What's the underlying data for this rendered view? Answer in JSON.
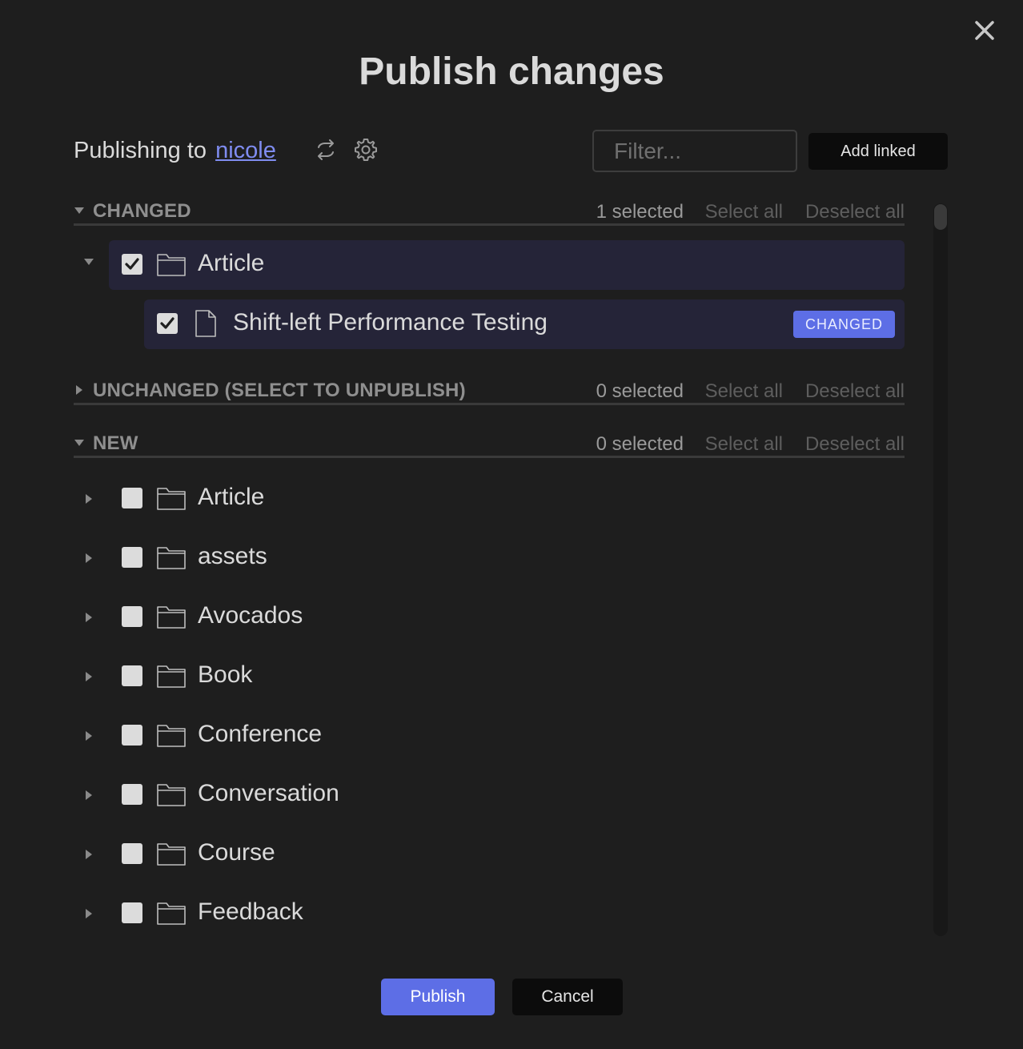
{
  "dialog": {
    "title": "Publish changes",
    "close_icon": "close-icon"
  },
  "publishing": {
    "prefix": "Publishing to",
    "target": "nicole",
    "swap_icon": "swap-arrows-icon",
    "settings_icon": "gear-icon"
  },
  "filter": {
    "placeholder": "Filter...",
    "value": ""
  },
  "add_linked_label": "Add linked",
  "sections": {
    "changed": {
      "title": "CHANGED",
      "expanded": true,
      "selected": "1 selected",
      "select_all": "Select all",
      "deselect_all": "Deselect all",
      "items": [
        {
          "label": "Article",
          "type": "folder",
          "checked": true,
          "expanded": true,
          "children": [
            {
              "label": "Shift-left Performance Testing",
              "type": "file",
              "checked": true,
              "badge": "CHANGED"
            }
          ]
        }
      ]
    },
    "unchanged": {
      "title": "UNCHANGED (SELECT TO UNPUBLISH)",
      "expanded": false,
      "selected": "0 selected",
      "select_all": "Select all",
      "deselect_all": "Deselect all"
    },
    "new": {
      "title": "NEW",
      "expanded": true,
      "selected": "0 selected",
      "select_all": "Select all",
      "deselect_all": "Deselect all",
      "items": [
        {
          "label": "Article",
          "type": "folder",
          "checked": false
        },
        {
          "label": "assets",
          "type": "folder",
          "checked": false
        },
        {
          "label": "Avocados",
          "type": "folder",
          "checked": false
        },
        {
          "label": "Book",
          "type": "folder",
          "checked": false
        },
        {
          "label": "Conference",
          "type": "folder",
          "checked": false
        },
        {
          "label": "Conversation",
          "type": "folder",
          "checked": false
        },
        {
          "label": "Course",
          "type": "folder",
          "checked": false
        },
        {
          "label": "Feedback",
          "type": "folder",
          "checked": false
        }
      ]
    }
  },
  "footer": {
    "publish_label": "Publish",
    "cancel_label": "Cancel"
  },
  "colors": {
    "accent": "#5d6ee6",
    "link": "#7f8cf0",
    "background": "#1e1e1e",
    "highlight_row": "#252438"
  }
}
